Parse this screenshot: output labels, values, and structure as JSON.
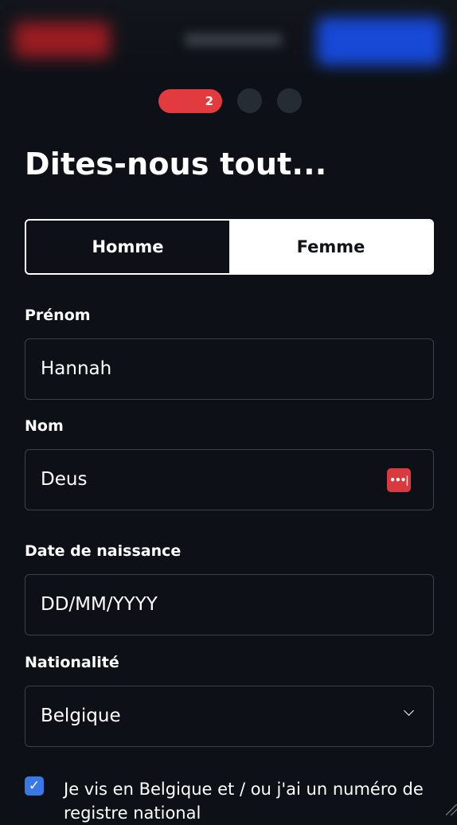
{
  "stepper": {
    "current_step": "2",
    "total_steps": 3
  },
  "form": {
    "title": "Dites-nous tout...",
    "gender": {
      "options": [
        "Homme",
        "Femme"
      ],
      "selected": "Femme"
    },
    "first_name": {
      "label": "Prénom",
      "value": "Hannah"
    },
    "last_name": {
      "label": "Nom",
      "value": "Deus",
      "password_manager_icon": "password-manager-icon"
    },
    "birth_date": {
      "label": "Date de naissance",
      "placeholder": "DD/MM/YYYY"
    },
    "nationality": {
      "label": "Nationalité",
      "value": "Belgique"
    },
    "residency_checkbox": {
      "checked": true,
      "label": "Je vis en Belgique et / ou j'ai un numéro de registre national"
    }
  },
  "colors": {
    "background": "#0d1117",
    "accent_red": "#e23b3f",
    "checkbox_blue": "#3a78e6",
    "field_border": "#3b4148"
  }
}
